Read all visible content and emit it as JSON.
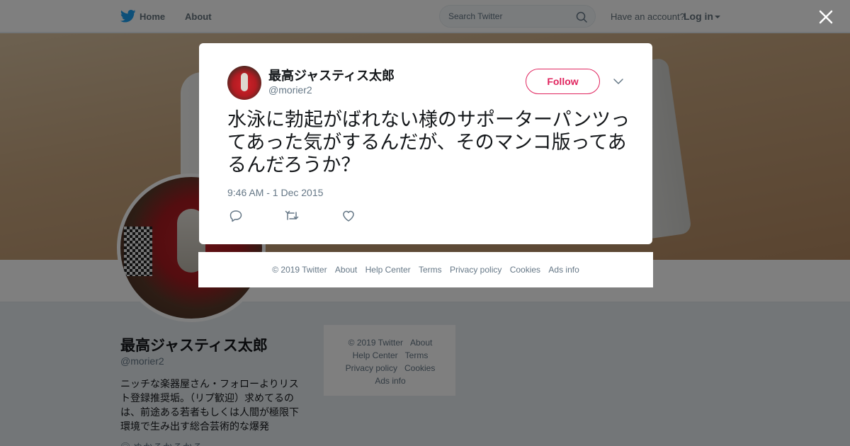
{
  "topbar": {
    "home_label": "Home",
    "about_label": "About",
    "search_placeholder": "Search Twitter",
    "have_account": "Have an account?",
    "login_label": "Log in"
  },
  "profile": {
    "name": "最高ジャスティス太郎",
    "handle": "@morier2",
    "bio": "ニッチな楽器屋さん・フォローよりリスト登録推奨垢。（リプ歓迎）求めてるのは、前途ある若者もしくは人間が極限下環境で生み出す総合芸術的な爆発",
    "more": "◎ ぬかるかるかる"
  },
  "side_footer": {
    "links": [
      "© 2019 Twitter",
      "About",
      "Help Center",
      "Terms",
      "Privacy policy",
      "Cookies",
      "Ads info"
    ]
  },
  "tweet": {
    "fullname": "最高ジャスティス太郎",
    "handle": "@morier2",
    "follow_label": "Follow",
    "text": "水泳に勃起がばれない様のサポーターパンツってあった気がするんだが、そのマンコ版ってあるんだろうか？",
    "timestamp": "9:46 AM - 1 Dec 2015"
  },
  "modal_footer": {
    "links": [
      "© 2019 Twitter",
      "About",
      "Help Center",
      "Terms",
      "Privacy policy",
      "Cookies",
      "Ads info"
    ]
  },
  "icons": {
    "bird": "twitter-bird-icon",
    "search": "search-icon",
    "close": "close-icon",
    "menu": "chevron-down-icon",
    "reply": "reply-icon",
    "retweet": "retweet-icon",
    "like": "heart-icon"
  },
  "colors": {
    "brand": "#1da1f2",
    "follow": "#e0245e",
    "muted": "#657786"
  }
}
